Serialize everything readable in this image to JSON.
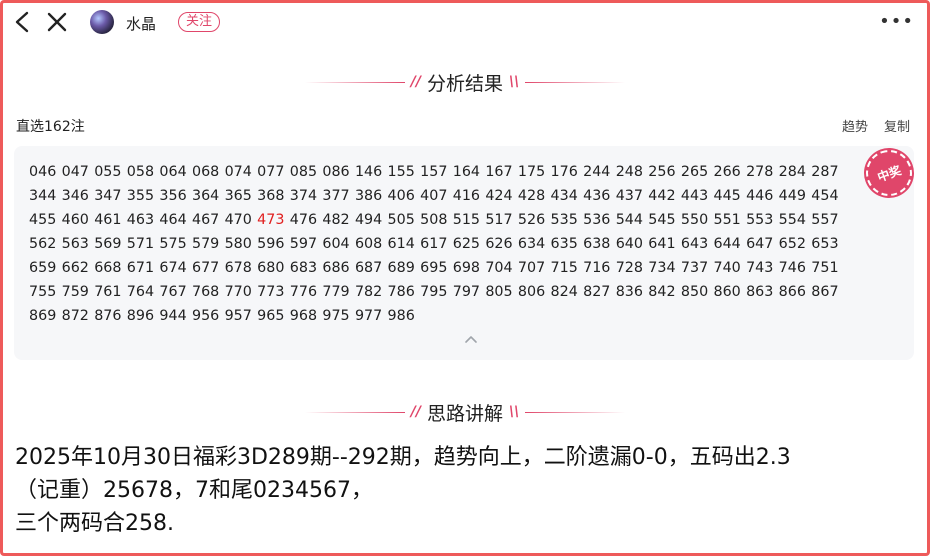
{
  "header": {
    "username": "水晶",
    "follow_label": "关注"
  },
  "result_section": {
    "title": "分析结果",
    "picks_count": "直选162注",
    "trend_label": "趋势",
    "copy_label": "复制",
    "badge": "中奖",
    "rows": [
      [
        "046",
        "047",
        "055",
        "058",
        "064",
        "068",
        "074",
        "077",
        "085",
        "086",
        "146",
        "155",
        "157",
        "164",
        "167",
        "175",
        "176",
        "244",
        "248",
        "256",
        "265",
        "266",
        "278",
        "284",
        "287"
      ],
      [
        "344",
        "346",
        "347",
        "355",
        "356",
        "364",
        "365",
        "368",
        "374",
        "377",
        "386",
        "406",
        "407",
        "416",
        "424",
        "428",
        "434",
        "436",
        "437",
        "442",
        "443",
        "445",
        "446",
        "449",
        "454"
      ],
      [
        "455",
        "460",
        "461",
        "463",
        "464",
        "467",
        "470",
        "473",
        "476",
        "482",
        "494",
        "505",
        "508",
        "515",
        "517",
        "526",
        "535",
        "536",
        "544",
        "545",
        "550",
        "551",
        "553",
        "554",
        "557"
      ],
      [
        "562",
        "563",
        "569",
        "571",
        "575",
        "579",
        "580",
        "596",
        "597",
        "604",
        "608",
        "614",
        "617",
        "625",
        "626",
        "634",
        "635",
        "638",
        "640",
        "641",
        "643",
        "644",
        "647",
        "652",
        "653"
      ],
      [
        "659",
        "662",
        "668",
        "671",
        "674",
        "677",
        "678",
        "680",
        "683",
        "686",
        "687",
        "689",
        "695",
        "698",
        "704",
        "707",
        "715",
        "716",
        "728",
        "734",
        "737",
        "740",
        "743",
        "746",
        "751"
      ],
      [
        "755",
        "759",
        "761",
        "764",
        "767",
        "768",
        "770",
        "773",
        "776",
        "779",
        "782",
        "786",
        "795",
        "797",
        "805",
        "806",
        "824",
        "827",
        "836",
        "842",
        "850",
        "860",
        "863",
        "866",
        "867"
      ],
      [
        "869",
        "872",
        "876",
        "896",
        "944",
        "956",
        "957",
        "965",
        "968",
        "975",
        "977",
        "986"
      ]
    ],
    "highlighted": "473",
    "highlight_color": "#e02020"
  },
  "explain_section": {
    "title": "思路讲解",
    "lines": [
      "2025年10月30日福彩3D289期--292期，趋势向上，二阶遗漏0-0，五码出2.3",
      "（记重）25678，7和尾0234567，",
      "三个两码合258."
    ]
  },
  "colors": {
    "accent": "#e0466a",
    "frame": "#ee5a5a"
  }
}
